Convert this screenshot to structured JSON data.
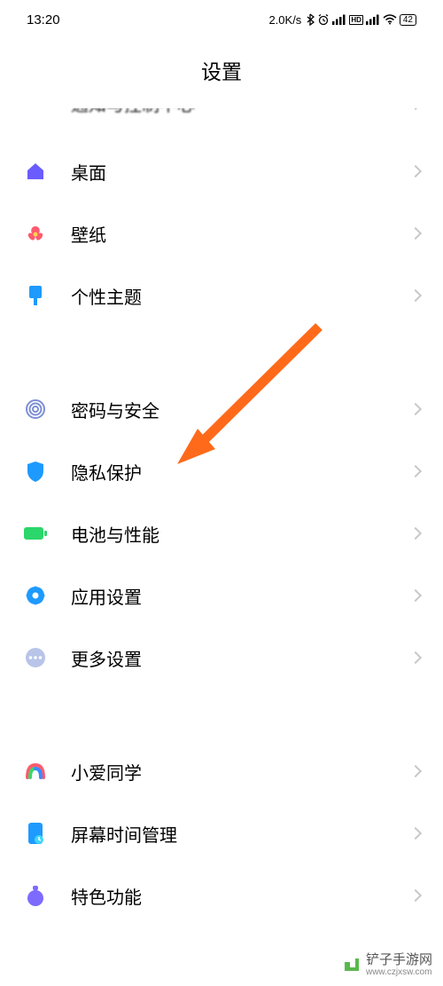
{
  "status": {
    "time": "13:20",
    "speed": "2.0K/s",
    "battery": "42"
  },
  "header": {
    "title": "设置"
  },
  "partial_item": {
    "label": "通知与控制中心"
  },
  "group1": [
    {
      "label": "桌面",
      "icon": "home"
    },
    {
      "label": "壁纸",
      "icon": "wallpaper"
    },
    {
      "label": "个性主题",
      "icon": "theme"
    }
  ],
  "group2": [
    {
      "label": "密码与安全",
      "icon": "fingerprint"
    },
    {
      "label": "隐私保护",
      "icon": "shield"
    },
    {
      "label": "电池与性能",
      "icon": "battery"
    },
    {
      "label": "应用设置",
      "icon": "app-settings"
    },
    {
      "label": "更多设置",
      "icon": "more"
    }
  ],
  "group3": [
    {
      "label": "小爱同学",
      "icon": "xiaoai"
    },
    {
      "label": "屏幕时间管理",
      "icon": "screen-time"
    },
    {
      "label": "特色功能",
      "icon": "special"
    }
  ],
  "watermark": {
    "brand": "铲子手游网",
    "url": "www.czjxsw.com"
  }
}
